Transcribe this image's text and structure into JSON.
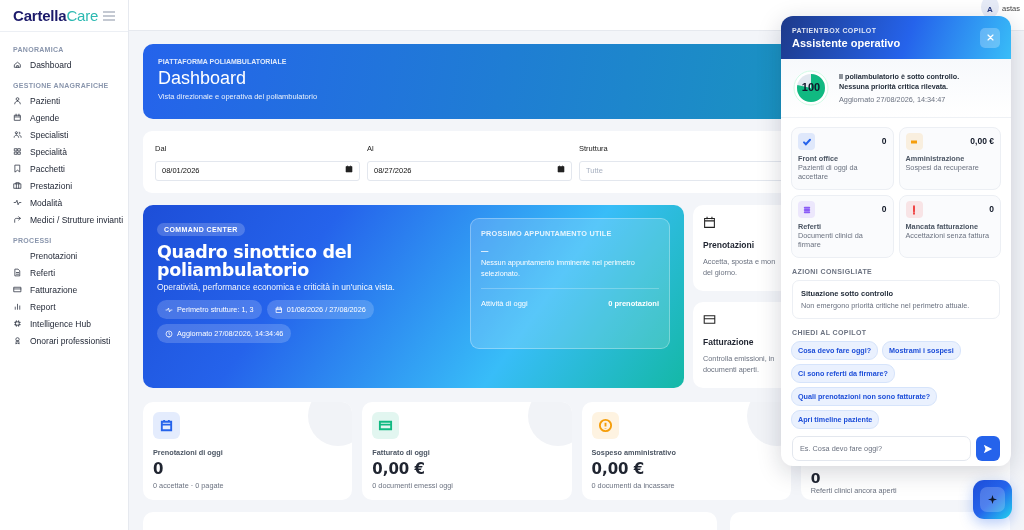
{
  "sidebar": {
    "logo": {
      "primary": "Cartella",
      "accent": "Care"
    },
    "sections": [
      {
        "label": "PANORAMICA",
        "items": [
          {
            "label": "Dashboard",
            "selected": false
          }
        ]
      },
      {
        "label": "GESTIONE ANAGRAFICHE",
        "items": [
          {
            "label": "Pazienti",
            "selected": false
          },
          {
            "label": "Agende",
            "selected": false
          },
          {
            "label": "Specialisti",
            "selected": false
          },
          {
            "label": "Specialità",
            "selected": false
          },
          {
            "label": "Pacchetti",
            "selected": false
          },
          {
            "label": "Prestazioni",
            "selected": false
          },
          {
            "label": "Modalità",
            "selected": false
          },
          {
            "label": "Medici / Strutture invianti",
            "selected": false
          }
        ]
      },
      {
        "label": "PROCESSI",
        "items": [
          {
            "label": "Prenotazioni",
            "selected": false
          },
          {
            "label": "Referti",
            "selected": false
          },
          {
            "label": "Fatturazione",
            "selected": false
          },
          {
            "label": "Report",
            "selected": false
          },
          {
            "label": "Intelligence Hub",
            "selected": false
          },
          {
            "label": "Onorari professionisti",
            "selected": false
          }
        ]
      }
    ]
  },
  "topbar": {
    "avatar": "A",
    "user": "astas"
  },
  "header": {
    "eyebrow": "PIATTAFORMA POLIAMBULATORIALE",
    "title": "Dashboard",
    "subtitle": "Vista direzionale e operativa del poliambulatorio"
  },
  "filters": [
    {
      "label": "Dal",
      "value": "08/01/2026",
      "kind": "date"
    },
    {
      "label": "Al",
      "value": "08/27/2026",
      "kind": "date"
    },
    {
      "label": "Struttura",
      "placeholder": "Tutte",
      "kind": "select"
    }
  ],
  "command_center": {
    "badge": "COMMAND CENTER",
    "title": "Quadro sinottico del poliambulatorio",
    "subtitle": "Operatività, performance economica e criticità in un'unica vista.",
    "chips": [
      "Perimetro strutture: 1, 3",
      "01/08/2026 / 27/08/2026",
      "Aggiornato 27/08/2026, 14:34:46"
    ],
    "next": {
      "eyebrow": "PROSSIMO APPUNTAMENTO UTILE",
      "dash": "—",
      "message": "Nessun appuntamento imminente nel perimetro selezionato.",
      "row_label": "Attività di oggi",
      "row_value": "0 prenotazioni"
    }
  },
  "quick_cards": [
    {
      "title": "Prenotazioni",
      "lines": [
        "Accetta, sposta e mon",
        "del giorno."
      ]
    },
    {
      "title": "Fatturazione",
      "lines": [
        "Controlla emissioni, in",
        "documenti aperti."
      ]
    }
  ],
  "kpis": [
    {
      "label": "Prenotazioni di oggi",
      "value": "0",
      "sub": "0 accettate · 0 pagate",
      "color": "#2563eb"
    },
    {
      "label": "Fatturato di oggi",
      "value": "0,00 €",
      "sub": "0 documenti emessi oggi",
      "color": "#10b981"
    },
    {
      "label": "Sospeso amministrativo",
      "value": "0,00 €",
      "sub": "0 documenti da incassare",
      "color": "#f59e0b"
    },
    {
      "value": "0",
      "sub": "Referti clinici ancora aperti"
    }
  ],
  "copilot": {
    "eyebrow": "PATIENTBOX COPILOT",
    "title": "Assistente operativo",
    "score": "100",
    "level": 0.78,
    "status_lines": [
      "Il poliambulatorio è sotto controllo.",
      "Nessuna priorità critica rilevata."
    ],
    "updated": "Aggiornato 27/08/2026, 14:34:47",
    "tiles": [
      {
        "title": "Front office",
        "desc": "Pazienti di oggi da accettare",
        "value": "0",
        "color": "#2563eb"
      },
      {
        "title": "Amministrazione",
        "desc": "Sospesi da recuperare",
        "value": "0,00 €",
        "color": "#f59e0b"
      },
      {
        "title": "Referti",
        "desc": "Documenti clinici da firmare",
        "value": "0",
        "color": "#8b5cf6"
      },
      {
        "title": "Mancata fatturazione",
        "desc": "Accettazioni senza fattura",
        "value": "0",
        "color": "#ef4444"
      }
    ],
    "actions_label": "AZIONI CONSIGLIATE",
    "action": {
      "title": "Situazione sotto controllo",
      "desc": "Non emergono priorità critiche nel perimetro attuale."
    },
    "ask_label": "CHIEDI AL COPILOT",
    "suggestions": [
      "Cosa devo fare oggi?",
      "Mostrami i sospesi",
      "Ci sono referti da firmare?",
      "Quali prenotazioni non sono fatturate?",
      "Apri timeline paziente"
    ],
    "input": {
      "placeholder": "Es. Cosa devo fare oggi?"
    }
  }
}
